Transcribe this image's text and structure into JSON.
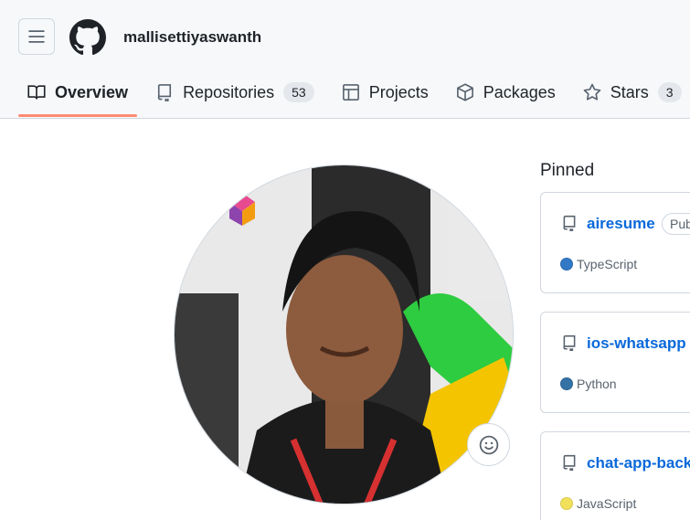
{
  "header": {
    "username": "mallisettiyaswanth"
  },
  "tabs": [
    {
      "label": "Overview",
      "icon": "book-icon",
      "active": true
    },
    {
      "label": "Repositories",
      "icon": "repo-icon",
      "count": "53"
    },
    {
      "label": "Projects",
      "icon": "table-icon"
    },
    {
      "label": "Packages",
      "icon": "package-icon"
    },
    {
      "label": "Stars",
      "icon": "star-icon",
      "count": "3"
    }
  ],
  "pinned": {
    "title": "Pinned",
    "items": [
      {
        "name": "airesume",
        "visibility": "Public",
        "language": "TypeScript",
        "language_color": "#3178c6"
      },
      {
        "name": "ios-whatsapp",
        "visibility": "",
        "language": "Python",
        "language_color": "#3572A5"
      },
      {
        "name": "chat-app-backend",
        "visibility": "",
        "language": "JavaScript",
        "language_color": "#f1e05a"
      }
    ]
  },
  "colors": {
    "accent": "#0969da",
    "tab_underline": "#fd8c73",
    "header_bg": "#f6f8fa"
  }
}
